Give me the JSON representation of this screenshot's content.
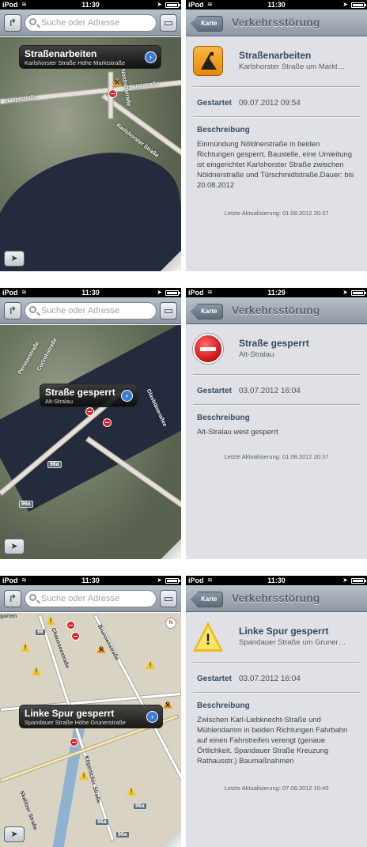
{
  "status": {
    "carrier": "iPod",
    "times_left": [
      "11:30",
      "11:30",
      "11:30"
    ],
    "times_right": [
      "11:30",
      "11:29",
      "11:30"
    ]
  },
  "mapbar": {
    "search_placeholder": "Suche oder Adresse"
  },
  "detail_nav": {
    "back_label": "Karte",
    "title": "Verkehrsstörung"
  },
  "labels": {
    "started": "Gestartet",
    "description": "Beschreibung"
  },
  "incidents": [
    {
      "callout_title": "Straßenarbeiten",
      "callout_subtitle": "Karlshorster Straße Höhe Marktstraße",
      "detail_title": "Straßenarbeiten",
      "detail_subtitle": "Karlshorster Straße um Markt…",
      "icon": "roadwork-icon",
      "started": "09.07.2012 09:54",
      "description": "Einmündung Nöldnerstraße in beiden Richtungen gesperrt. Baustelle, eine Umleitung ist eingerichtet Karlshorster Straße zwischen Nöldnerstraße und Türschmidtstraße.Dauer: bis 20.08.2012",
      "updated": "Letzte Aktualisierung: 01.08.2012 20:37",
      "map_labels": [
        "Hauptstraße",
        "Hauptstraße",
        "Karlshorster Straße",
        "Nöldnerstraße"
      ]
    },
    {
      "callout_title": "Straße gesperrt",
      "callout_subtitle": "Alt-Stralau",
      "detail_title": "Straße gesperrt",
      "detail_subtitle": "Alt-Stralau",
      "icon": "no-entry-icon",
      "started": "03.07.2012 16:04",
      "description": "Alt-Stralau west gesperrt",
      "updated": "Letzte Aktualisierung: 01.08.2012 20:37",
      "map_labels": [
        "Corinthstraße",
        "Persiusstraße",
        "Glasbläserallee",
        "96a",
        "96a"
      ]
    },
    {
      "callout_title": "Linke Spur gesperrt",
      "callout_subtitle": "Spandauer Straße Höhe Grunerstraße",
      "detail_title": "Linke Spur gesperrt",
      "detail_subtitle": "Spandauer Straße um Gruner…",
      "icon": "warning-icon",
      "started": "03.07.2012 16:04",
      "description": "Zwischen Karl-Liebknecht-Straße und Mühlendamm in beiden Richtungen Fahrbahn auf einen Fahrstreifen verengt (genaue Örtlichkeit. Spandauer Straße Kreuzung Rathausstr.) Baumaßnahmen",
      "updated": "Letzte Aktualisierung: 07.08.2012 10:40",
      "map_labels": [
        "garten",
        "96",
        "Chausseestraße",
        "Brunnenstraße",
        "Köpenicker Straße",
        "96a",
        "96a",
        "96a",
        "Skalitzer Straße"
      ]
    }
  ]
}
